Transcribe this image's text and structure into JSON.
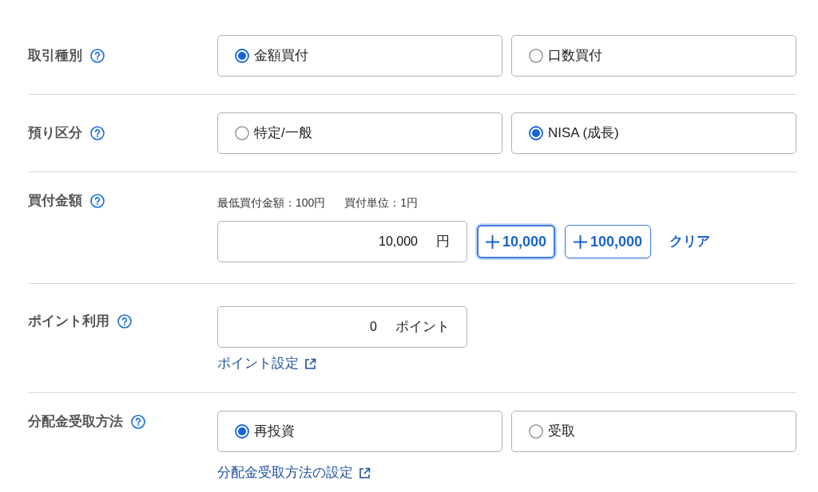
{
  "rows": [
    {
      "kind": "choice",
      "label": "取引種別",
      "options": [
        {
          "label": "金額買付",
          "selected": true
        },
        {
          "label": "口数買付",
          "selected": false
        }
      ]
    },
    {
      "kind": "choice",
      "label": "預り区分",
      "options": [
        {
          "label": "特定/一般",
          "selected": false
        },
        {
          "label": "NISA (成長)",
          "selected": true
        }
      ]
    },
    {
      "kind": "amount",
      "label": "買付金額",
      "hints": [
        "最低買付金額：100円",
        "買付単位：1円"
      ],
      "input": {
        "value": "10,000",
        "unit": "円"
      },
      "buttons": [
        {
          "label": "10,000",
          "focused": true
        },
        {
          "label": "100,000",
          "focused": false
        }
      ],
      "clear": "クリア"
    },
    {
      "kind": "points",
      "label": "ポイント利用",
      "input": {
        "value": "0",
        "unit": "ポイント"
      },
      "link": "ポイント設定"
    },
    {
      "kind": "choice",
      "label": "分配金受取方法",
      "options": [
        {
          "label": "再投資",
          "selected": true
        },
        {
          "label": "受取",
          "selected": false
        }
      ],
      "link": "分配金受取方法の設定"
    }
  ]
}
